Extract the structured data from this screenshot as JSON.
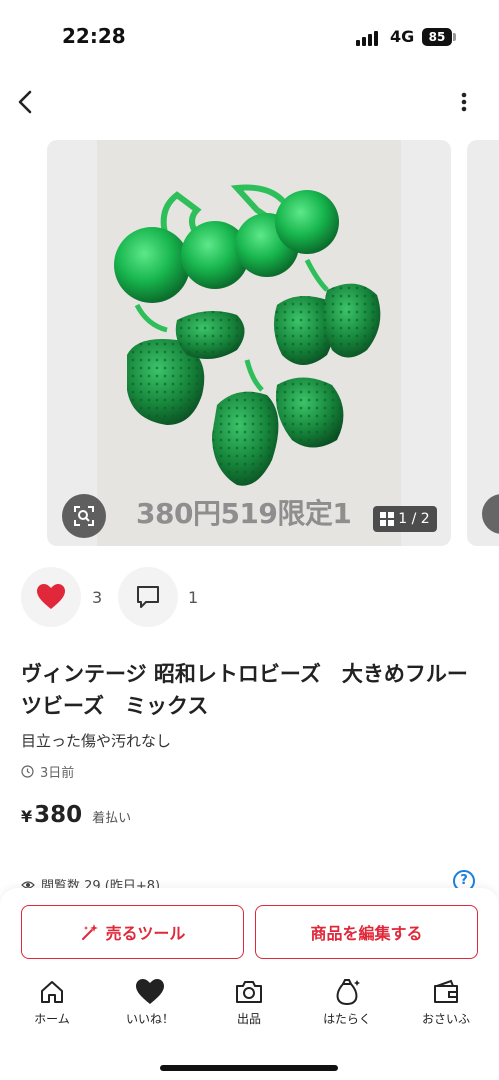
{
  "status_bar": {
    "time": "22:28",
    "network": "4G",
    "battery": "85"
  },
  "gallery": {
    "watermark": "380円519限定1",
    "counter": "1 / 2"
  },
  "actions": {
    "like_count": "3",
    "comment_count": "1"
  },
  "item": {
    "title": "ヴィンテージ 昭和レトロビーズ　大きめフルーツビーズ　ミックス",
    "subtitle": "目立った傷や汚れなし",
    "posted": "3日前",
    "currency": "¥",
    "price": "380",
    "shipping": "着払い",
    "views": "閲覧数  29 (昨日+8)"
  },
  "buttons": {
    "sell_tool": "売るツール",
    "edit_item": "商品を編集する"
  },
  "tabbar": {
    "items": [
      {
        "label": "ホーム",
        "icon": "home-icon"
      },
      {
        "label": "いいね！",
        "icon": "heart-icon"
      },
      {
        "label": "出品",
        "icon": "camera-icon"
      },
      {
        "label": "はたらく",
        "icon": "money-bag-icon"
      },
      {
        "label": "おさいふ",
        "icon": "wallet-icon"
      }
    ]
  },
  "colors": {
    "accent": "#e0283a",
    "help": "#1a7fdd",
    "like": "#e0283a"
  }
}
